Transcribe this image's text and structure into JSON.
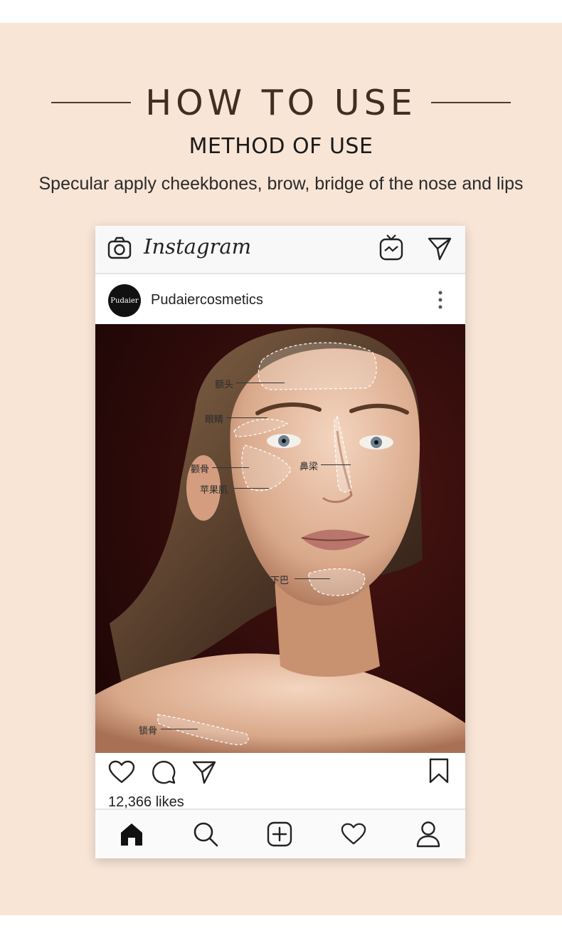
{
  "header": {
    "title": "HOW TO USE",
    "subtitle": "METHOD OF USE",
    "description": "Specular apply cheekbones, brow, bridge of the nose and lips"
  },
  "instagram": {
    "app_name": "Instagram",
    "top_icons": [
      "camera-icon",
      "igtv-icon",
      "send-icon"
    ],
    "account": {
      "avatar_text": "Pudaier",
      "username": "Pudaiercosmetics",
      "menu_icon": "more-vertical-icon"
    },
    "face_labels": {
      "forehead": "额头",
      "eyes": "眼睛",
      "cheekbone": "颧骨",
      "nose_bridge": "鼻梁",
      "apple_cheek": "苹果肌",
      "chin": "下巴",
      "collarbone": "锁骨"
    },
    "action_icons": [
      "heart-icon",
      "comment-icon",
      "send-icon",
      "bookmark-icon"
    ],
    "likes": "12,366 likes",
    "nav_icons": [
      "home-icon",
      "search-icon",
      "add-icon",
      "activity-heart-icon",
      "profile-icon"
    ]
  },
  "colors": {
    "page_background": "#ffffff",
    "panel_background": "#f8e5d6",
    "title_color": "#3e2f22",
    "photo_background": "#3a0f0d",
    "skin": "#e8bfa3"
  }
}
